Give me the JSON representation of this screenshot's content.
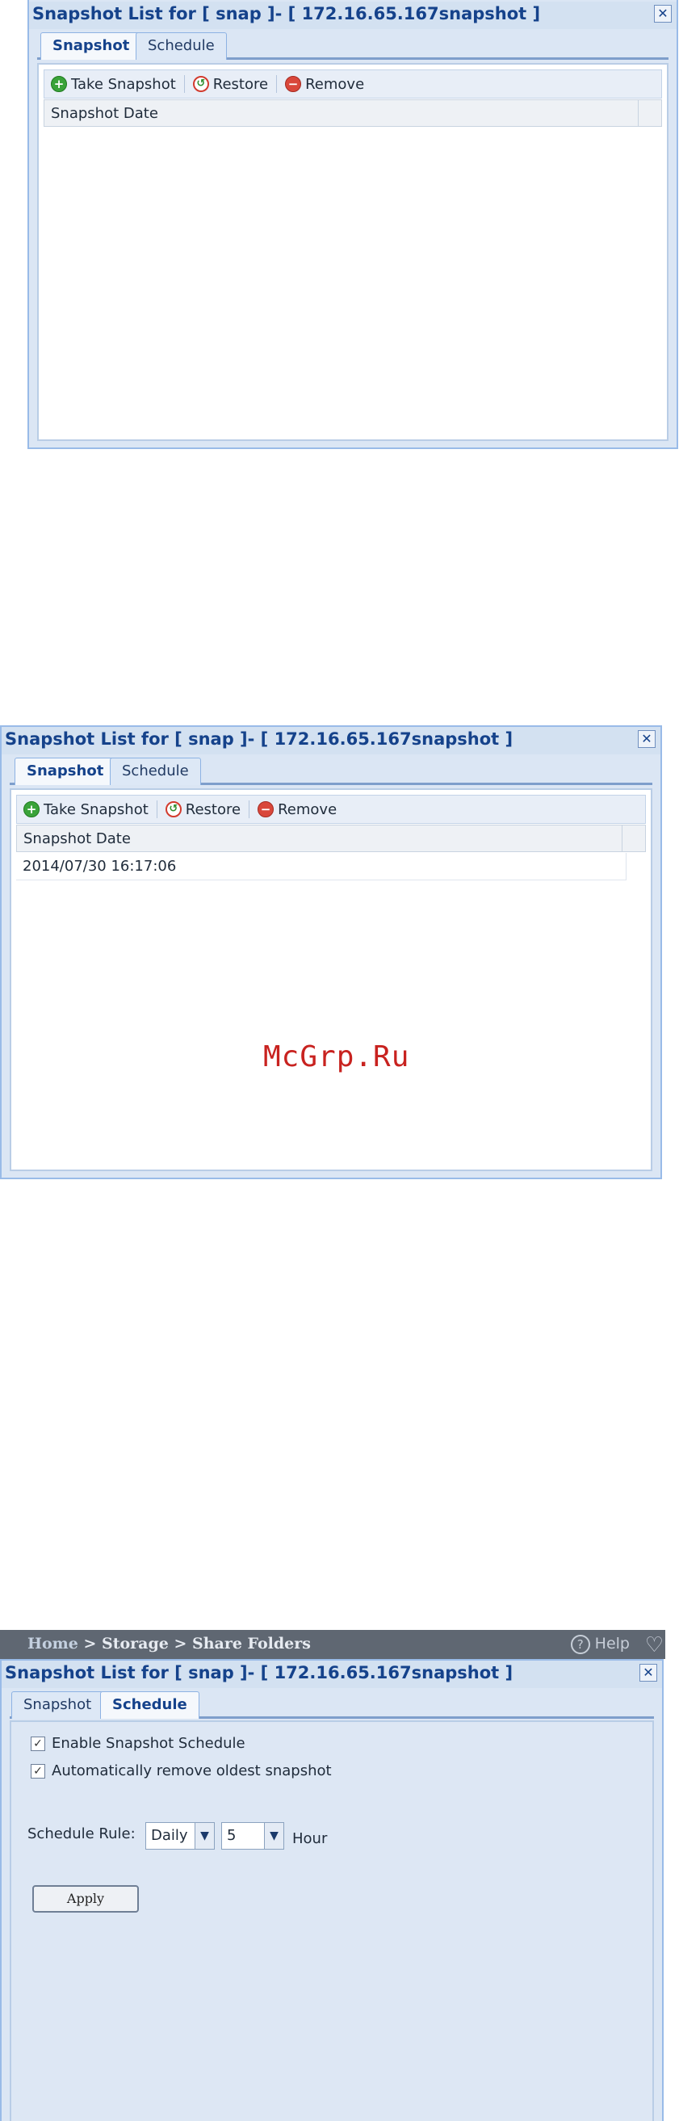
{
  "window_title": "Snapshot List for [ snap ]- [ 172.16.65.167snapshot ]",
  "close_glyph": "✕",
  "tabs": {
    "snapshot": "Snapshot",
    "schedule": "Schedule"
  },
  "toolbar": {
    "take_snapshot": "Take Snapshot",
    "restore": "Restore",
    "remove": "Remove"
  },
  "grid": {
    "column_header": "Snapshot Date"
  },
  "panel2": {
    "rows": [
      "2014/07/30 16:17:06"
    ]
  },
  "watermark": "McGrp.Ru",
  "breadcrumb": {
    "home": "Home",
    "path": " > Storage > Share Folders",
    "help": "Help"
  },
  "schedule": {
    "enable_label": "Enable Snapshot Schedule",
    "enable_checked": true,
    "auto_remove_label": "Automatically remove oldest snapshot",
    "auto_remove_checked": true,
    "rule_label": "Schedule Rule:",
    "frequency_value": "Daily",
    "hour_value": "5",
    "hour_label": "Hour",
    "apply_label": "Apply"
  }
}
